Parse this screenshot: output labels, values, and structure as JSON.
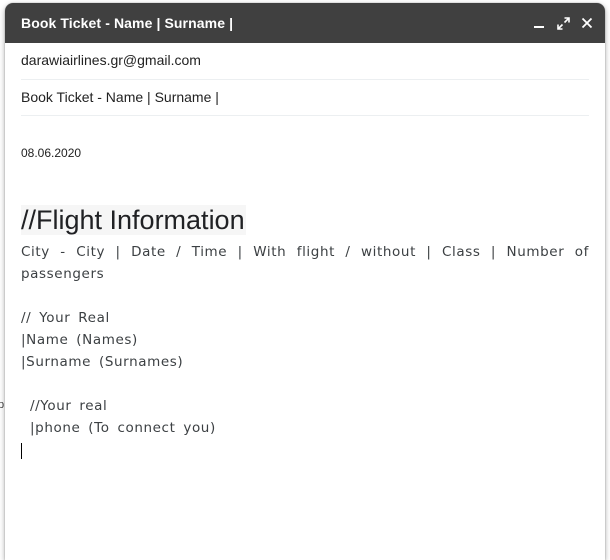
{
  "window": {
    "title": "Book Ticket - Name | Surname |",
    "controls": [
      {
        "name": "minimize-icon"
      },
      {
        "name": "expand-icon"
      },
      {
        "name": "close-icon"
      }
    ]
  },
  "compose": {
    "to": "darawiairlines.gr@gmail.com",
    "subject": "Book Ticket - Name | Surname |"
  },
  "body": {
    "date": "08.06.2020",
    "heading": "//Flight Information",
    "info_line": "City - City | Date / Time | With flight / without | Class | Number of passengers",
    "real_name_comment": "// Your Real",
    "name_line": "|Name (Names)",
    "surname_line": "|Surname (Surnames)",
    "phone_comment": "//Your real",
    "phone_line": "|phone (To connect you)"
  },
  "colors": {
    "titlebar": "#404040",
    "title_text": "#ffffff",
    "body_text": "#3c4043"
  }
}
